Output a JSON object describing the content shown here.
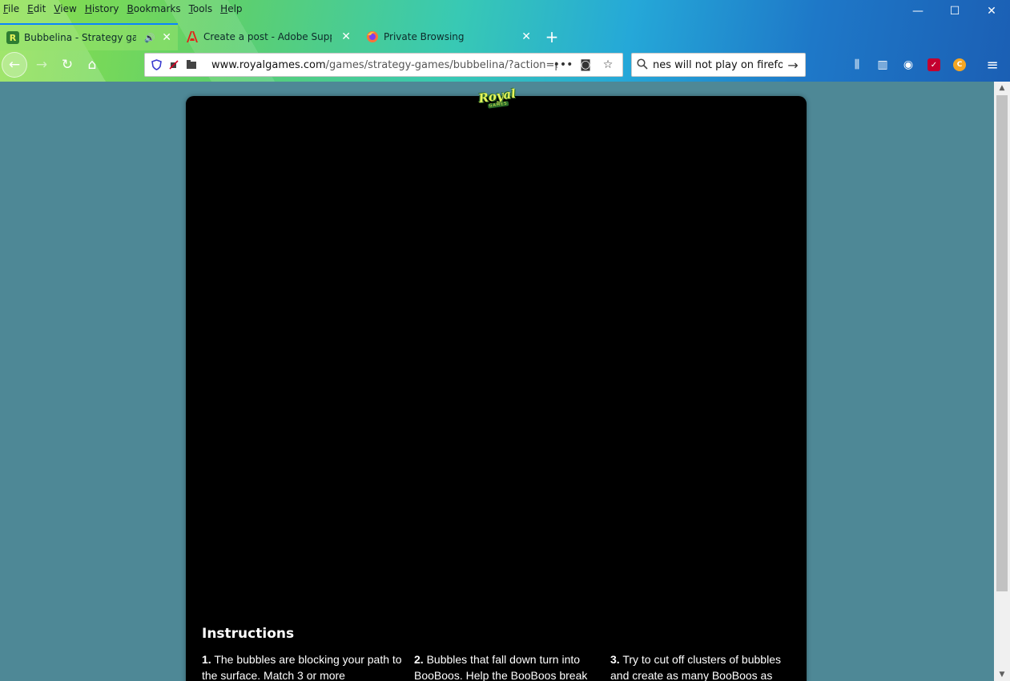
{
  "menubar": {
    "items": [
      "File",
      "Edit",
      "View",
      "History",
      "Bookmarks",
      "Tools",
      "Help"
    ]
  },
  "window_controls": {
    "minimize": "—",
    "maximize": "☐",
    "close": "✕"
  },
  "tabs": [
    {
      "title": "Bubbelina - Strategy game...",
      "favicon": "R",
      "active": true,
      "audio": "🔊"
    },
    {
      "title": "Create a post - Adobe Support",
      "favicon": "adobe-icon",
      "active": false
    },
    {
      "title": "Private Browsing",
      "favicon": "firefox-icon",
      "active": false
    }
  ],
  "tab_close_glyph": "✕",
  "new_tab_glyph": "+",
  "nav": {
    "back": "←",
    "forward": "→",
    "reload": "↻",
    "home": "⌂"
  },
  "urlbar": {
    "domain": "www.royalgames.com",
    "path": "/games/strategy-games/bubbelina/?action=play&",
    "more": "•••",
    "pocket": "◙",
    "star": "☆"
  },
  "searchbar": {
    "value": "nes will not play on firefox",
    "go": "→"
  },
  "toolbar": {
    "library": "⫼",
    "sidebar": "▥",
    "account": "◉",
    "ext1": "✓",
    "ext2": "C",
    "menu": "≡"
  },
  "page": {
    "logo": {
      "word": "Royal",
      "sub": "GAMES"
    },
    "instructions": {
      "heading": "Instructions",
      "steps": [
        {
          "num": "1.",
          "text": "The bubbles are blocking your path to the surface. Match 3 or more"
        },
        {
          "num": "2.",
          "text": "Bubbles that fall down turn into BooBoos. Help the BooBoos break"
        },
        {
          "num": "3.",
          "text": "Try to cut off clusters of bubbles and create as many BooBoos as"
        }
      ]
    }
  },
  "scrollbar": {
    "up": "▲",
    "down": "▼"
  },
  "colors": {
    "page_bg": "#4e8896",
    "game_bg": "#000000",
    "accent": "#0a84ff"
  }
}
